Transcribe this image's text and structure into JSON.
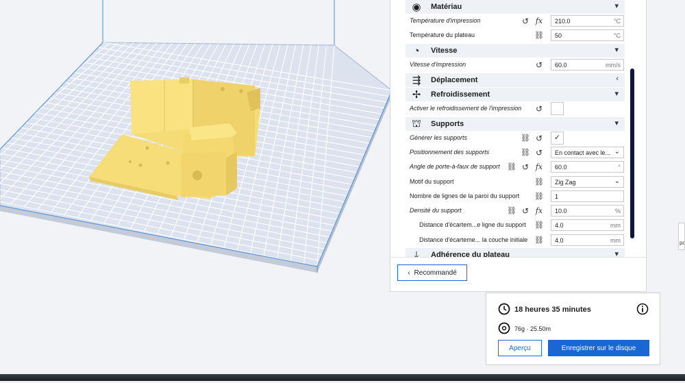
{
  "panel": {
    "categories": {
      "materiau": {
        "title": "Matériau",
        "icon": "material-icon"
      },
      "vitesse": {
        "title": "Vitesse",
        "icon": "speed-gauge-icon"
      },
      "deplacement": {
        "title": "Déplacement",
        "icon": "travel-icon"
      },
      "refroidissement": {
        "title": "Refroidissement",
        "icon": "fan-icon"
      },
      "supports": {
        "title": "Supports",
        "icon": "support-icon"
      },
      "adherence": {
        "title": "Adhérence du plateau",
        "icon": "adhesion-icon"
      }
    },
    "settings": {
      "temp_impression": {
        "label": "Température d'impression",
        "value": "210.0",
        "unit": "°C"
      },
      "temp_plateau": {
        "label": "Température du plateau",
        "value": "50",
        "unit": "°C"
      },
      "vitesse_impression": {
        "label": "Vitesse d'impression",
        "value": "60.0",
        "unit": "mm/s"
      },
      "activer_refroidissement": {
        "label": "Activer le refroidissement de l'impression",
        "checked": false
      },
      "generer_supports": {
        "label": "Générer les supports",
        "checked": true,
        "check_glyph": "✓"
      },
      "positionnement_supports": {
        "label": "Positionnement des supports",
        "value": "En contact avec le..."
      },
      "angle_porte_a_faux": {
        "label": "Angle de porte-à-faux de support",
        "value": "60.0",
        "unit": "°"
      },
      "motif_support": {
        "label": "Motif du support",
        "value": "Zig Zag"
      },
      "nombre_lignes_paroi": {
        "label": "Nombre de lignes de la paroi du support",
        "value": "1"
      },
      "densite_support": {
        "label": "Densité du support",
        "value": "10.0",
        "unit": "%"
      },
      "distance_ligne": {
        "label": "Distance d'écartem...e ligne du support",
        "value": "4.0",
        "unit": "mm"
      },
      "distance_couche": {
        "label": "Distance d'écarteme... la couche initiale",
        "value": "4.0",
        "unit": "mm"
      }
    },
    "recommended_button": "Recommandé"
  },
  "print_info": {
    "time": "18 heures 35 minutes",
    "material": "76g · 25.50m",
    "preview_button": "Aperçu",
    "save_button": "Enregistrer sur le disque"
  },
  "edge_text": "po",
  "colors": {
    "accent": "#1a66d2",
    "model": "#f7dd77",
    "plate": "#dde3ee",
    "plate_grid": "#ffffff",
    "build_volume": "#4b8fe0",
    "scrollbar": "#11163f"
  }
}
